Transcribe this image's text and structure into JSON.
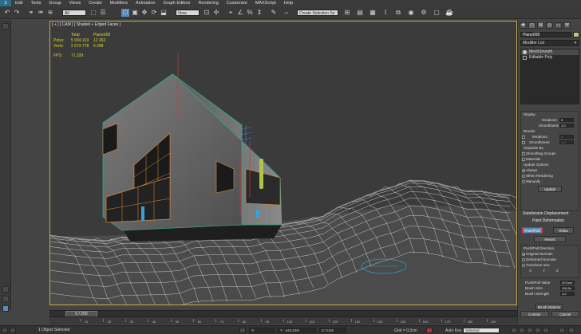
{
  "menu": [
    "Edit",
    "Tools",
    "Group",
    "Views",
    "Create",
    "Modifiers",
    "Animation",
    "Graph Editors",
    "Rendering",
    "Customize",
    "MAXScript",
    "Help"
  ],
  "toolbar": {
    "filter_dropdown": "All",
    "refcoord_dropdown": "View",
    "selset_dropdown": "Create Selection Se"
  },
  "viewport": {
    "label": "[ + ] [ CAM ] [ Shaded + Edged Faces ]",
    "stats": {
      "header_total": "Total",
      "header_object": "Plane008",
      "polys_label": "Polys:",
      "polys_total": "5 934 103",
      "polys_object": "12 362",
      "verts_label": "Verts:",
      "verts_total": "2 673 778",
      "verts_object": "6 288",
      "fps_label": "FPS:",
      "fps_value": "71,329"
    }
  },
  "time": {
    "slider_label": "0 / 200",
    "ticks": [
      "10",
      "20",
      "30",
      "40",
      "50",
      "60",
      "70",
      "80",
      "90",
      "100",
      "110",
      "120",
      "130",
      "140",
      "150",
      "160",
      "170",
      "180",
      "190"
    ]
  },
  "status": {
    "selection": "1 Object Selected",
    "x_field": "X:",
    "y_field": "Y: -442,03m",
    "z_field": "Z: 0,0m",
    "grid": "Grid = 0,0cm",
    "autokey": "Auto Key",
    "selected": "Selected"
  },
  "command_panel": {
    "object_name": "Plane008",
    "modifier_list": "Modifier List",
    "stack": [
      "MeshSmooth",
      "Editable Poly"
    ],
    "display": {
      "title": "Display",
      "iterations_label": "Iterations:",
      "iterations": "0",
      "smoothness_label": "Smoothness:",
      "smoothness": "1,0"
    },
    "render": {
      "title": "Render",
      "iterations_label": "Iterations:",
      "iterations": "0",
      "smoothness_label": "Smoothness:",
      "smoothness": "1,0"
    },
    "separate": {
      "title": "Separate By",
      "smoothing_groups": "Smoothing Groups",
      "materials": "Materials"
    },
    "update": {
      "title": "Update Options",
      "always": "Always",
      "when_rendering": "When Rendering",
      "manually": "Manually",
      "update_button": "Update"
    },
    "subdivision_displacement": "Subdivision Displacement",
    "paint_deformation": "Paint Deformation",
    "push_pull": "Push/Pull",
    "relax": "Relax",
    "revert": "Revert",
    "direction": {
      "title": "Push/Pull Direction",
      "original_normals": "Original Normals",
      "deformed_normals": "Deformed Normals",
      "transform_axis": "Transform axis",
      "x": "X",
      "y": "Y",
      "z": "Z"
    },
    "brush": {
      "value_label": "Push/Pull Value",
      "value": "20,0cm",
      "size_label": "Brush Size",
      "size": "100,0c",
      "strength_label": "Brush Strength",
      "strength": "1,0"
    },
    "brush_options": "Brush Options",
    "commit": "Commit",
    "cancel": "Cancel"
  },
  "colors": {
    "viewport_border": "#c9a94a",
    "selection_blue": "#5a8ab8",
    "stats_text": "#d7d72f",
    "wire_edges": "#2fa88a",
    "window_grid": "#d98a3a"
  }
}
